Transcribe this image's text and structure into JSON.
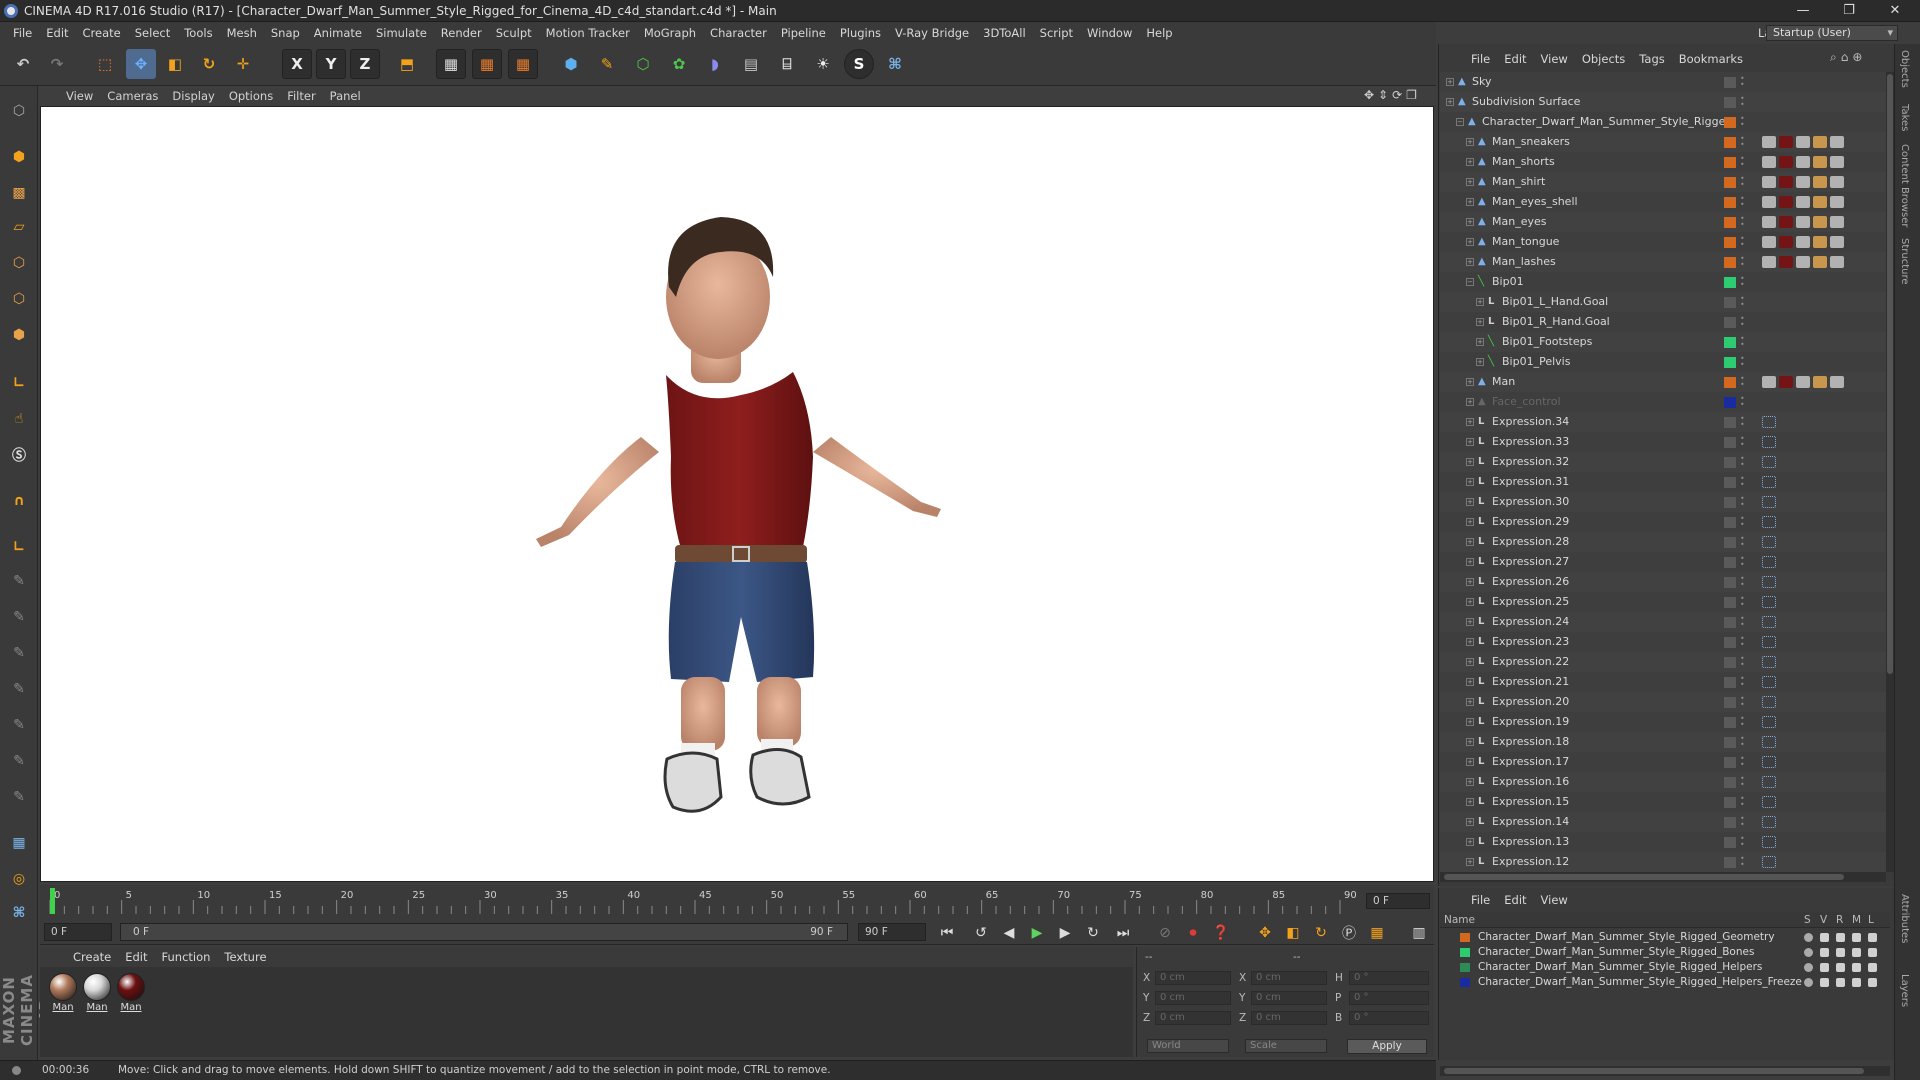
{
  "window": {
    "title": "CINEMA 4D R17.016 Studio (R17) - [Character_Dwarf_Man_Summer_Style_Rigged_for_Cinema_4D_c4d_standart.c4d *] - Main",
    "minimize": "—",
    "restore": "❐",
    "close": "✕"
  },
  "menubar": [
    "File",
    "Edit",
    "Create",
    "Select",
    "Tools",
    "Mesh",
    "Snap",
    "Animate",
    "Simulate",
    "Render",
    "Sculpt",
    "Motion Tracker",
    "MoGraph",
    "Character",
    "Pipeline",
    "Plugins",
    "V-Ray Bridge",
    "3DToAll",
    "Script",
    "Window",
    "Help"
  ],
  "layout": {
    "label": "Layout:",
    "value": "Startup (User)"
  },
  "toolbar": {
    "axis_x": "X",
    "axis_y": "Y",
    "axis_z": "Z",
    "icons": [
      "undo-icon",
      "redo-icon",
      "live-selection-icon",
      "move-icon",
      "scale-icon",
      "rotate-icon",
      "last-tool-icon",
      "x-axis-icon",
      "y-axis-icon",
      "z-axis-icon",
      "world-coords-icon",
      "render-view-icon",
      "render-picture-viewer-icon",
      "edit-render-settings-icon",
      "cube-icon",
      "pen-icon",
      "subdivision-icon",
      "array-icon",
      "deformer-icon",
      "floor-icon",
      "camera-icon",
      "light-icon",
      "sketch-icon",
      "python-icon"
    ]
  },
  "viewport": {
    "menu": [
      "View",
      "Cameras",
      "Display",
      "Options",
      "Filter",
      "Panel"
    ]
  },
  "timeline": {
    "ticks": [
      "0",
      "5",
      "10",
      "15",
      "20",
      "25",
      "30",
      "35",
      "40",
      "45",
      "50",
      "55",
      "60",
      "65",
      "70",
      "75",
      "80",
      "85",
      "90"
    ],
    "current_frame": "0 F",
    "start_field": "0 F",
    "slider_start": "0 F",
    "slider_end": "90 F",
    "end_field": "90 F"
  },
  "materials": {
    "menu": [
      "Create",
      "Edit",
      "Function",
      "Texture"
    ],
    "items": [
      {
        "label": "Man",
        "color": "#b07a5c"
      },
      {
        "label": "Man",
        "color": "#d8d8d8"
      },
      {
        "label": "Man",
        "color": "#6b1010"
      }
    ]
  },
  "coordinates": {
    "header": "--",
    "header2": "--",
    "rows": [
      {
        "axis": "X",
        "pos": "0 cm",
        "axis2": "X",
        "size": "0 cm",
        "rot_label": "H",
        "rot": "0 °"
      },
      {
        "axis": "Y",
        "pos": "0 cm",
        "axis2": "Y",
        "size": "0 cm",
        "rot_label": "P",
        "rot": "0 °"
      },
      {
        "axis": "Z",
        "pos": "0 cm",
        "axis2": "Z",
        "size": "0 cm",
        "rot_label": "B",
        "rot": "0 °"
      }
    ],
    "mode": "World",
    "scale": "Scale",
    "apply": "Apply"
  },
  "status": {
    "time": "00:00:36",
    "message": "Move: Click and drag to move elements. Hold down SHIFT to quantize movement / add to the selection in point mode, CTRL to remove."
  },
  "objects": {
    "menu": [
      "File",
      "Edit",
      "View",
      "Objects",
      "Tags",
      "Bookmarks"
    ],
    "rows": [
      {
        "name": "Sky",
        "indent": 0,
        "color": "#5a5a5a"
      },
      {
        "name": "Subdivision Surface",
        "indent": 0,
        "color": "#5a5a5a"
      },
      {
        "name": "Character_Dwarf_Man_Summer_Style_Rigged",
        "indent": 1,
        "color": "#d2691e"
      },
      {
        "name": "Man_sneakers",
        "indent": 2,
        "color": "#d2691e"
      },
      {
        "name": "Man_shorts",
        "indent": 2,
        "color": "#d2691e"
      },
      {
        "name": "Man_shirt",
        "indent": 2,
        "color": "#d2691e"
      },
      {
        "name": "Man_eyes_shell",
        "indent": 2,
        "color": "#d2691e"
      },
      {
        "name": "Man_eyes",
        "indent": 2,
        "color": "#d2691e"
      },
      {
        "name": "Man_tongue",
        "indent": 2,
        "color": "#d2691e"
      },
      {
        "name": "Man_lashes",
        "indent": 2,
        "color": "#d2691e"
      },
      {
        "name": "Bip01",
        "indent": 2,
        "color": "#2ecc71"
      },
      {
        "name": "Bip01_L_Hand.Goal",
        "indent": 3,
        "color": "#5a5a5a"
      },
      {
        "name": "Bip01_R_Hand.Goal",
        "indent": 3,
        "color": "#5a5a5a"
      },
      {
        "name": "Bip01_Footsteps",
        "indent": 3,
        "color": "#2ecc71"
      },
      {
        "name": "Bip01_Pelvis",
        "indent": 3,
        "color": "#2ecc71"
      },
      {
        "name": "Man",
        "indent": 2,
        "color": "#d2691e"
      },
      {
        "name": "Face_control",
        "indent": 2,
        "color": "#1a2aa0"
      },
      {
        "name": "Expression.34",
        "indent": 2,
        "color": "#5a5a5a"
      },
      {
        "name": "Expression.33",
        "indent": 2,
        "color": "#5a5a5a"
      },
      {
        "name": "Expression.32",
        "indent": 2,
        "color": "#5a5a5a"
      },
      {
        "name": "Expression.31",
        "indent": 2,
        "color": "#5a5a5a"
      },
      {
        "name": "Expression.30",
        "indent": 2,
        "color": "#5a5a5a"
      },
      {
        "name": "Expression.29",
        "indent": 2,
        "color": "#5a5a5a"
      },
      {
        "name": "Expression.28",
        "indent": 2,
        "color": "#5a5a5a"
      },
      {
        "name": "Expression.27",
        "indent": 2,
        "color": "#5a5a5a"
      },
      {
        "name": "Expression.26",
        "indent": 2,
        "color": "#5a5a5a"
      },
      {
        "name": "Expression.25",
        "indent": 2,
        "color": "#5a5a5a"
      },
      {
        "name": "Expression.24",
        "indent": 2,
        "color": "#5a5a5a"
      },
      {
        "name": "Expression.23",
        "indent": 2,
        "color": "#5a5a5a"
      },
      {
        "name": "Expression.22",
        "indent": 2,
        "color": "#5a5a5a"
      },
      {
        "name": "Expression.21",
        "indent": 2,
        "color": "#5a5a5a"
      },
      {
        "name": "Expression.20",
        "indent": 2,
        "color": "#5a5a5a"
      },
      {
        "name": "Expression.19",
        "indent": 2,
        "color": "#5a5a5a"
      },
      {
        "name": "Expression.18",
        "indent": 2,
        "color": "#5a5a5a"
      },
      {
        "name": "Expression.17",
        "indent": 2,
        "color": "#5a5a5a"
      },
      {
        "name": "Expression.16",
        "indent": 2,
        "color": "#5a5a5a"
      },
      {
        "name": "Expression.15",
        "indent": 2,
        "color": "#5a5a5a"
      },
      {
        "name": "Expression.14",
        "indent": 2,
        "color": "#5a5a5a"
      },
      {
        "name": "Expression.13",
        "indent": 2,
        "color": "#5a5a5a"
      },
      {
        "name": "Expression.12",
        "indent": 2,
        "color": "#5a5a5a"
      }
    ]
  },
  "layers": {
    "menu": [
      "File",
      "Edit",
      "View"
    ],
    "columns": {
      "name": "Name",
      "s": "S",
      "v": "V",
      "r": "R",
      "m": "M",
      "l": "L"
    },
    "rows": [
      {
        "name": "Character_Dwarf_Man_Summer_Style_Rigged_Geometry",
        "color": "#d2691e"
      },
      {
        "name": "Character_Dwarf_Man_Summer_Style_Rigged_Bones",
        "color": "#2ecc71"
      },
      {
        "name": "Character_Dwarf_Man_Summer_Style_Rigged_Helpers",
        "color": "#2e8b57"
      },
      {
        "name": "Character_Dwarf_Man_Summer_Style_Rigged_Helpers_Freeze",
        "color": "#1a2aa0"
      }
    ]
  },
  "right_tabs": [
    "Objects",
    "Takes",
    "Content Browser",
    "Structure",
    "Attributes",
    "Layers"
  ]
}
